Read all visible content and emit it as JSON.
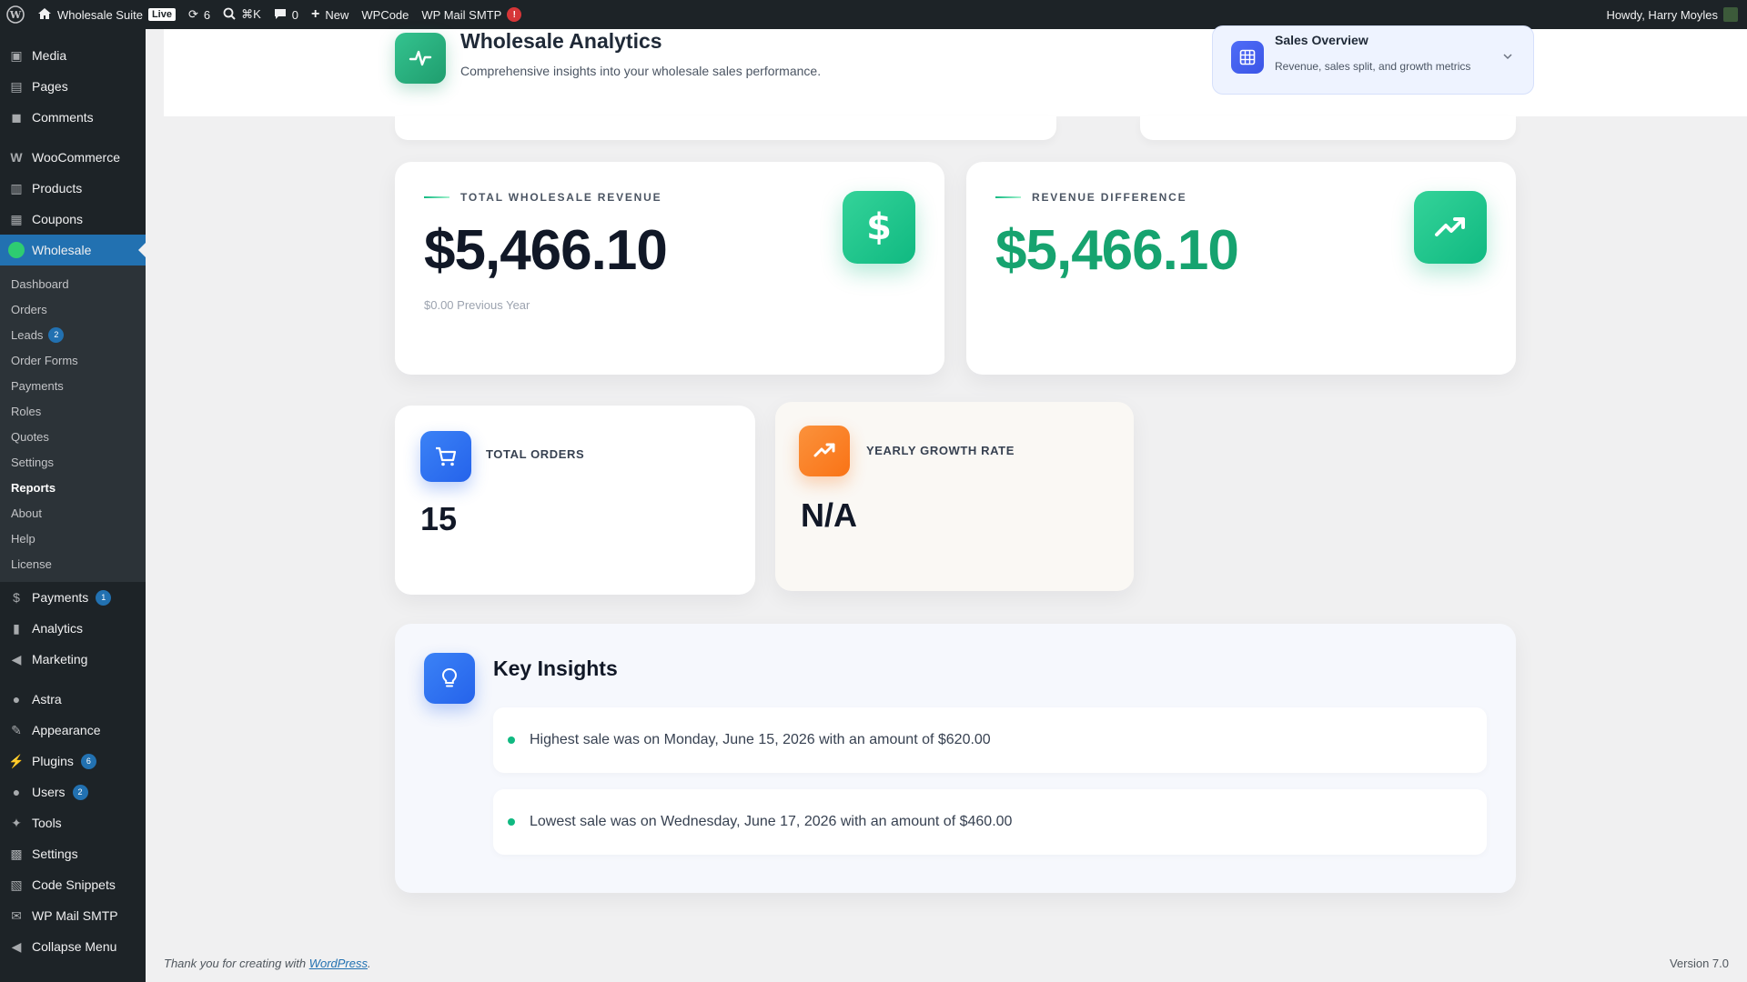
{
  "adminbar": {
    "site_name": "Wholesale Suite",
    "live_badge": "Live",
    "updates_count": "6",
    "shortcut": "⌘K",
    "comments_count": "0",
    "new_label": "New",
    "wpcode": "WPCode",
    "wpmail": "WP Mail SMTP",
    "wpmail_alert": "!",
    "howdy": "Howdy, Harry Moyles"
  },
  "sidebar": {
    "top_items": [
      {
        "label": "Media",
        "icon": "media-icon"
      },
      {
        "label": "Pages",
        "icon": "pages-icon"
      },
      {
        "label": "Comments",
        "icon": "comments-icon"
      }
    ],
    "woo_items": [
      {
        "label": "WooCommerce",
        "icon": "woocommerce-icon"
      },
      {
        "label": "Products",
        "icon": "products-icon"
      },
      {
        "label": "Coupons",
        "icon": "coupons-icon"
      }
    ],
    "active_item": "Wholesale",
    "submenu": [
      {
        "label": "Dashboard"
      },
      {
        "label": "Orders"
      },
      {
        "label": "Leads",
        "badge": "2"
      },
      {
        "label": "Order Forms"
      },
      {
        "label": "Payments"
      },
      {
        "label": "Roles"
      },
      {
        "label": "Quotes"
      },
      {
        "label": "Settings"
      },
      {
        "label": "Reports"
      },
      {
        "label": "About"
      },
      {
        "label": "Help"
      },
      {
        "label": "License"
      }
    ],
    "lower_items": [
      {
        "label": "Payments",
        "badge": "1"
      },
      {
        "label": "Analytics"
      },
      {
        "label": "Marketing"
      }
    ],
    "bottom_items": [
      {
        "label": "Astra"
      },
      {
        "label": "Appearance"
      },
      {
        "label": "Plugins",
        "badge": "6"
      },
      {
        "label": "Users",
        "badge": "2"
      },
      {
        "label": "Tools"
      },
      {
        "label": "Settings"
      },
      {
        "label": "Code Snippets"
      },
      {
        "label": "WP Mail SMTP"
      },
      {
        "label": "Collapse Menu"
      }
    ]
  },
  "header": {
    "title": "Wholesale Analytics",
    "subtitle": "Comprehensive insights into your wholesale sales performance."
  },
  "sales_overview": {
    "title": "Sales Overview",
    "subtitle": "Revenue, sales split, and growth metrics"
  },
  "revenue_card": {
    "label": "TOTAL WHOLESALE REVENUE",
    "value": "$5,466.10",
    "previous": "$0.00 Previous Year"
  },
  "difference_card": {
    "label": "REVENUE DIFFERENCE",
    "value": "$5,466.10"
  },
  "orders_card": {
    "label": "TOTAL ORDERS",
    "value": "15"
  },
  "growth_card": {
    "label": "YEARLY GROWTH RATE",
    "value": "N/A"
  },
  "insights": {
    "title": "Key Insights",
    "items": [
      "Highest sale was on Monday, June 15, 2026 with an amount of $620.00",
      "Lowest sale was on Wednesday, June 17, 2026 with an amount of $460.00"
    ]
  },
  "footer": {
    "text": "Thank you for creating with ",
    "link": "WordPress",
    "period": ".",
    "version": "Version 7.0"
  },
  "colors": {
    "accent_green": "#10b981",
    "wp_blue": "#2271b1",
    "adminbar_bg": "#1d2327"
  }
}
